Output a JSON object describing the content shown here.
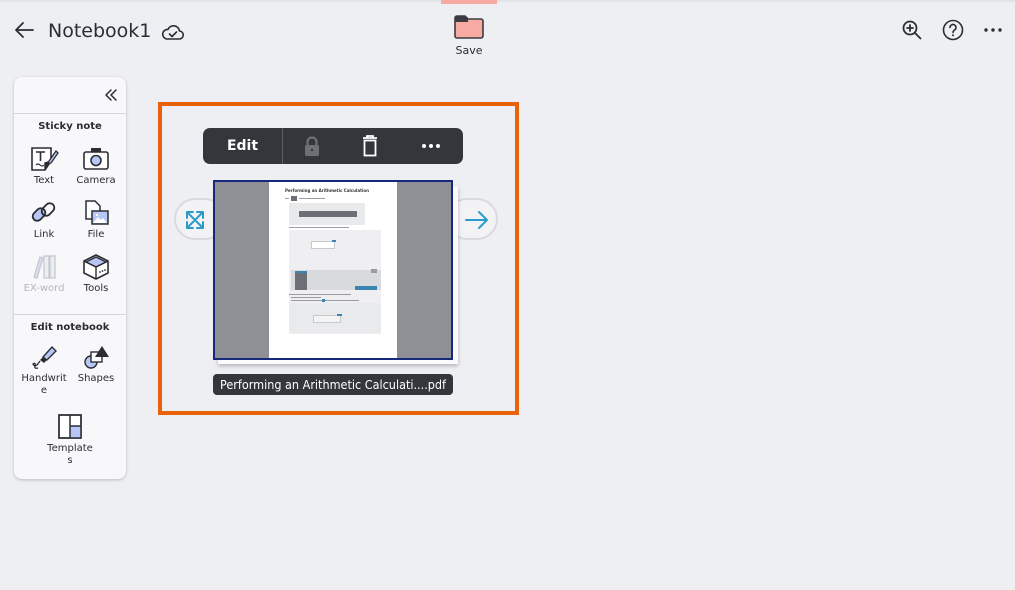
{
  "header": {
    "back_icon": "arrow-left-icon",
    "title": "Notebook1",
    "sync_icon": "cloud-check-icon",
    "save": {
      "label": "Save",
      "icon": "folder-icon",
      "accent": "#f7aaa1"
    },
    "actions": [
      {
        "name": "zoom-in",
        "icon": "zoom-in-icon"
      },
      {
        "name": "help",
        "icon": "help-icon"
      },
      {
        "name": "more",
        "icon": "more-icon"
      }
    ]
  },
  "sidebar": {
    "collapse_icon": "double-chevron-left-icon",
    "sticky_note": {
      "title": "Sticky note",
      "items": [
        {
          "label": "Text",
          "icon": "text-note-icon",
          "enabled": true
        },
        {
          "label": "Camera",
          "icon": "camera-icon",
          "enabled": true
        },
        {
          "label": "Link",
          "icon": "link-icon",
          "enabled": true
        },
        {
          "label": "File",
          "icon": "file-image-icon",
          "enabled": true
        },
        {
          "label": "EX-word",
          "icon": "dictionary-icon",
          "enabled": false
        },
        {
          "label": "Tools",
          "icon": "toolbox-icon",
          "enabled": true
        }
      ]
    },
    "edit_notebook": {
      "title": "Edit notebook",
      "items": [
        {
          "label": "Handwrite",
          "icon": "pen-icon",
          "enabled": true
        },
        {
          "label": "Shapes",
          "icon": "shapes-icon",
          "enabled": true
        },
        {
          "label": "Templates",
          "icon": "template-icon",
          "enabled": true
        }
      ]
    }
  },
  "selection": {
    "border_color": "#e8620a",
    "toolbar": {
      "edit_label": "Edit",
      "lock_icon": "lock-icon",
      "delete_icon": "trash-icon",
      "more_icon": "more-icon"
    },
    "expand_icon": "expand-icon",
    "next_icon": "arrow-right-icon",
    "document": {
      "page_title": "Performing an Arithmetic Calculation",
      "file_label": "Performing an Arithmetic Calculati....pdf"
    }
  }
}
